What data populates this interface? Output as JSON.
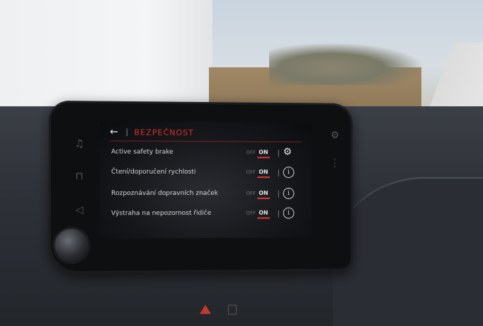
{
  "screen": {
    "title": "BEZPEČNOST",
    "back_icon": "back-arrow-icon",
    "rows": [
      {
        "label": "Active safety brake",
        "off": "OFF",
        "on": "ON",
        "icon": "gear-icon"
      },
      {
        "label": "Čtení/doporučení rychlosti",
        "off": "OFF",
        "on": "ON",
        "icon": "info-icon"
      },
      {
        "label": "Rozpoznávání dopravních značek",
        "off": "OFF",
        "on": "ON",
        "icon": "info-icon"
      },
      {
        "label": "Výstraha na nepozornost řidiče",
        "off": "OFF",
        "on": "ON",
        "icon": "info-icon"
      }
    ]
  },
  "side_icons": [
    "music-note-icon",
    "car-icon",
    "navigation-icon"
  ],
  "right_icons": [
    "settings-icon",
    "menu-icon"
  ],
  "colors": {
    "accent": "#d9332d",
    "toggle_underline": "#dd3333"
  }
}
